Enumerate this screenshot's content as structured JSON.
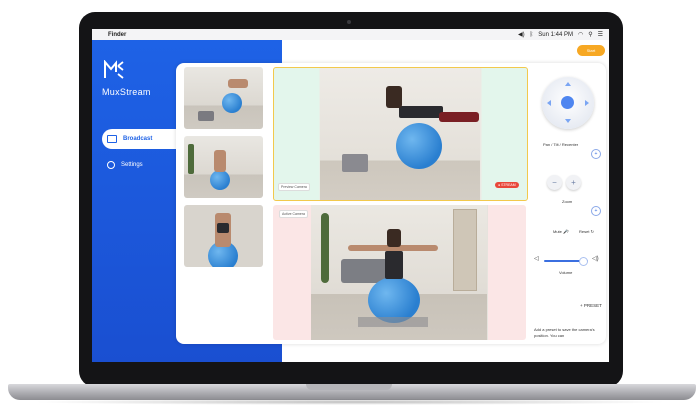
{
  "menubar": {
    "apple_icon": "",
    "app_name": "Finder",
    "clock": "Sun 1:44 PM"
  },
  "app": {
    "brand": "MuxStream",
    "start_button": "Start"
  },
  "sidebar": {
    "items": [
      {
        "label": "Broadcast",
        "active": true,
        "icon": "broadcast-icon"
      },
      {
        "label": "Settings",
        "active": false,
        "icon": "gear-icon"
      }
    ]
  },
  "feeds": {
    "top_tag": "Preview Camera",
    "live_badge": "● STREAM",
    "bottom_tag": "Active Camera"
  },
  "controls": {
    "pantilt_label": "Pan / Tilt / Recenter",
    "zoom_label": "Zoom",
    "mute_label": "Mute",
    "reset_label": "Reset",
    "volume_label": "Volume",
    "volume_level": 0.8,
    "preset_label": "+ PRESET",
    "preset_note": "Add a preset to save the camera's position. You can"
  },
  "colors": {
    "sidebar": "#1e62e6",
    "start": "#f7a823",
    "live": "#e9473a",
    "selected_feed_border": "#f2c94c"
  }
}
